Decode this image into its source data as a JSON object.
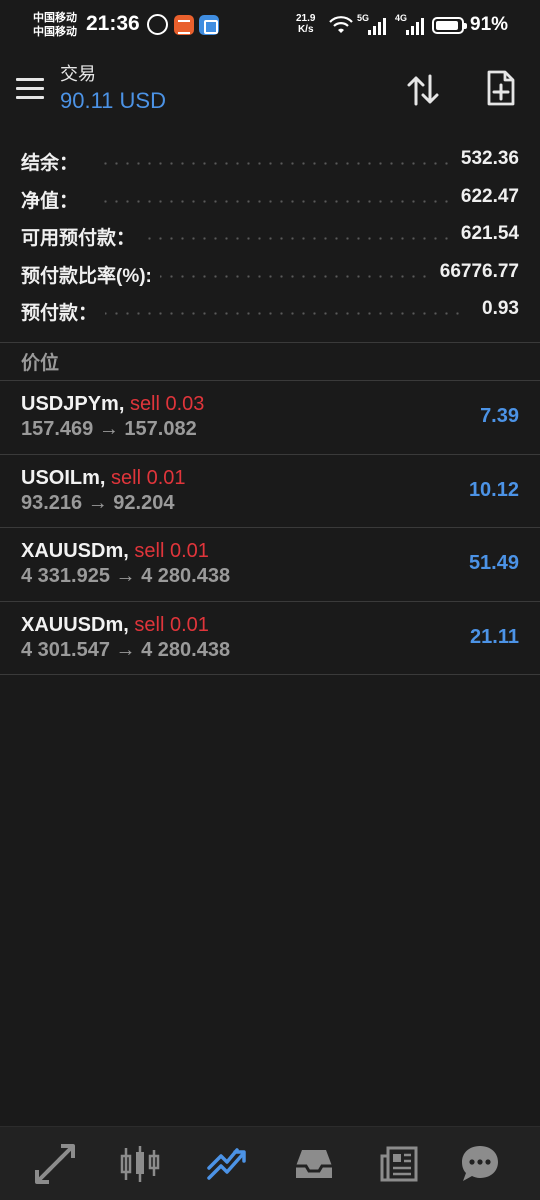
{
  "status_bar": {
    "carrier1": "中国移动",
    "carrier2": "中国移动",
    "time": "21:36",
    "speed_value": "21.9",
    "speed_unit": "K/s",
    "net1": "5G",
    "net2": "4G",
    "battery_pct": "91%",
    "battery_level": 0.91
  },
  "header": {
    "title": "交易",
    "subtitle": "90.11 USD"
  },
  "summary": [
    {
      "label": "结余：",
      "value": "532.36"
    },
    {
      "label": "净值：",
      "value": "622.47"
    },
    {
      "label": "可用预付款：",
      "value": "621.54"
    },
    {
      "label": "预付款比率(%):",
      "value": "66776.77"
    },
    {
      "label": "预付款：",
      "value": "0.93"
    }
  ],
  "section_title": "价位",
  "positions": [
    {
      "symbol": "USDJPYm",
      "side": "sell 0.03",
      "prices": "157.469 → 157.082",
      "profit": "7.39"
    },
    {
      "symbol": "USOILm",
      "side": "sell 0.01",
      "prices": "93.216 → 92.204",
      "profit": "10.12"
    },
    {
      "symbol": "XAUUSDm",
      "side": "sell 0.01",
      "prices": "4 331.925 → 4 280.438",
      "profit": "51.49"
    },
    {
      "symbol": "XAUUSDm",
      "side": "sell 0.01",
      "prices": "4 301.547 → 4 280.438",
      "profit": "21.11"
    }
  ],
  "colors": {
    "background": "#1a1a1a",
    "accent_blue": "#4c93e6",
    "sell_red": "#e0353b",
    "muted_gray": "#9a9a9a"
  },
  "bottom_nav": [
    {
      "icon": "quotes-icon",
      "active": false
    },
    {
      "icon": "chart-candles-icon",
      "active": false
    },
    {
      "icon": "trade-icon",
      "active": true
    },
    {
      "icon": "history-inbox-icon",
      "active": false
    },
    {
      "icon": "news-icon",
      "active": false
    },
    {
      "icon": "chat-icon",
      "active": false
    }
  ]
}
